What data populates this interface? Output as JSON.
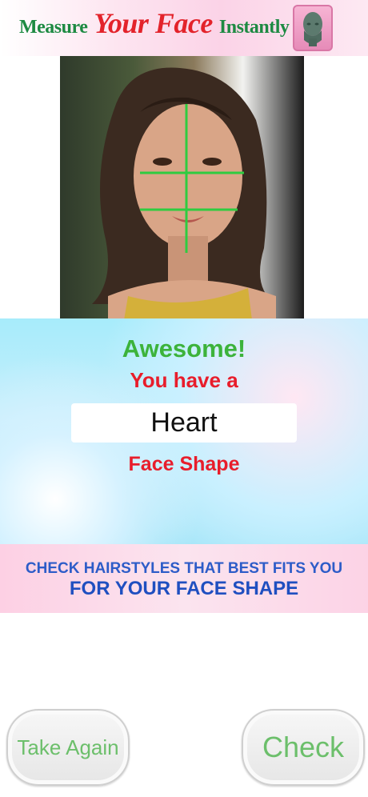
{
  "header": {
    "title_part1": "Measure",
    "title_part2": "Your Face",
    "title_part3": "Instantly",
    "logo_icon": "head-3d-icon"
  },
  "photo": {
    "overlay_icon": "face-measure-lines",
    "line_color": "#2ecc40"
  },
  "result": {
    "line1": "Awesome!",
    "line2": "You have a",
    "shape": "Heart",
    "line3": "Face Shape"
  },
  "cta": {
    "line1": "CHECK HAIRSTYLES THAT BEST FITS YOU",
    "line2": "FOR YOUR FACE SHAPE"
  },
  "buttons": {
    "take_again": "Take Again",
    "check": "Check"
  },
  "colors": {
    "accent_green": "#3cb33b",
    "accent_red": "#e81d2b",
    "accent_blue": "#1f4fc0"
  }
}
